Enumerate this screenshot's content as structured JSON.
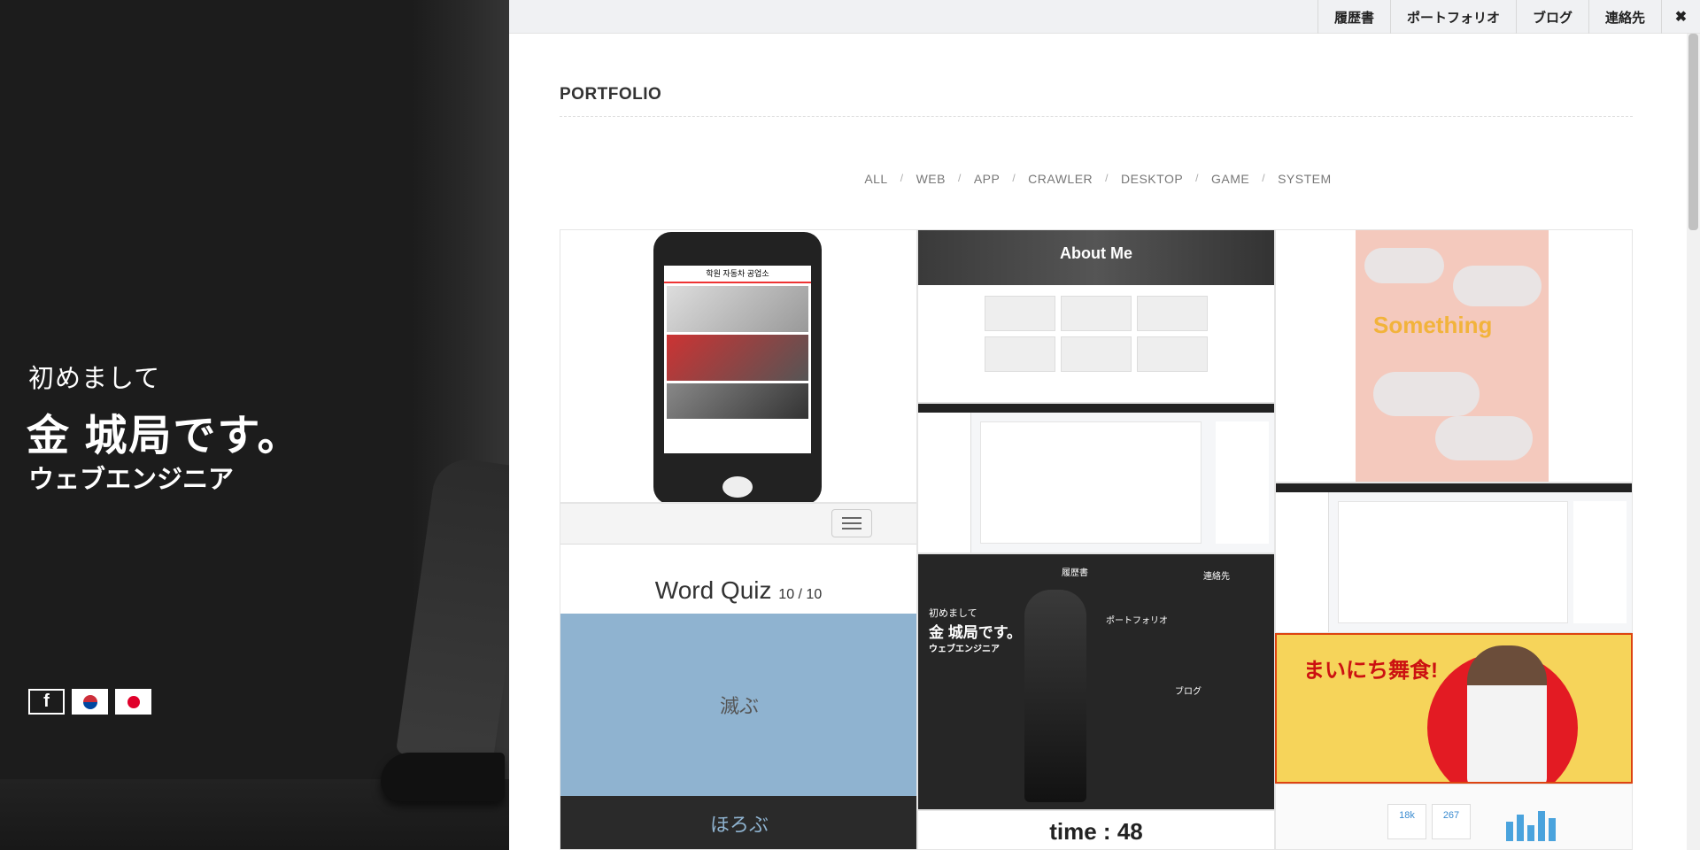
{
  "hero": {
    "greeting": "初めまして",
    "name": "金 城局です。",
    "role": "ウェブエンジニア",
    "socials": [
      {
        "id": "facebook",
        "label": "f",
        "icon": "facebook-icon"
      },
      {
        "id": "korea",
        "icon": "korea-flag-icon"
      },
      {
        "id": "japan",
        "icon": "japan-flag-icon"
      }
    ]
  },
  "nav": {
    "items": [
      "履歴書",
      "ポートフォリオ",
      "ブログ",
      "連絡先"
    ],
    "close_icon": "close-icon",
    "close_label": "✖"
  },
  "portfolio": {
    "title": "PORTFOLIO",
    "filters": [
      "ALL",
      "WEB",
      "APP",
      "CRAWLER",
      "DESKTOP",
      "GAME",
      "SYSTEM"
    ],
    "filter_separator": "/",
    "tiles": {
      "phone_app": {
        "title": "학원 자동차 공업소"
      },
      "quiz": {
        "title": "Word Quiz",
        "progress": "10 / 10",
        "answer_a": "滅ぶ",
        "answer_b": "ほろぶ"
      },
      "about": {
        "title": "About Me"
      },
      "self": {
        "greeting": "初めまして",
        "name": "金 城局です。",
        "role": "ウェブエンジニア",
        "link1": "履歴書",
        "link2": "連絡先",
        "link3": "ポートフォリオ",
        "link4": "ブログ"
      },
      "time": {
        "label": "time : 48"
      },
      "something": {
        "title": "Something"
      },
      "banner": {
        "title": "まいにち舞食!"
      },
      "dashboard": {
        "stat1": "18k",
        "stat2": "267"
      }
    }
  },
  "colors": {
    "panel": "#1c1c1c",
    "accent_red": "#e31b23",
    "quiz_blue": "#8fb3d0"
  }
}
